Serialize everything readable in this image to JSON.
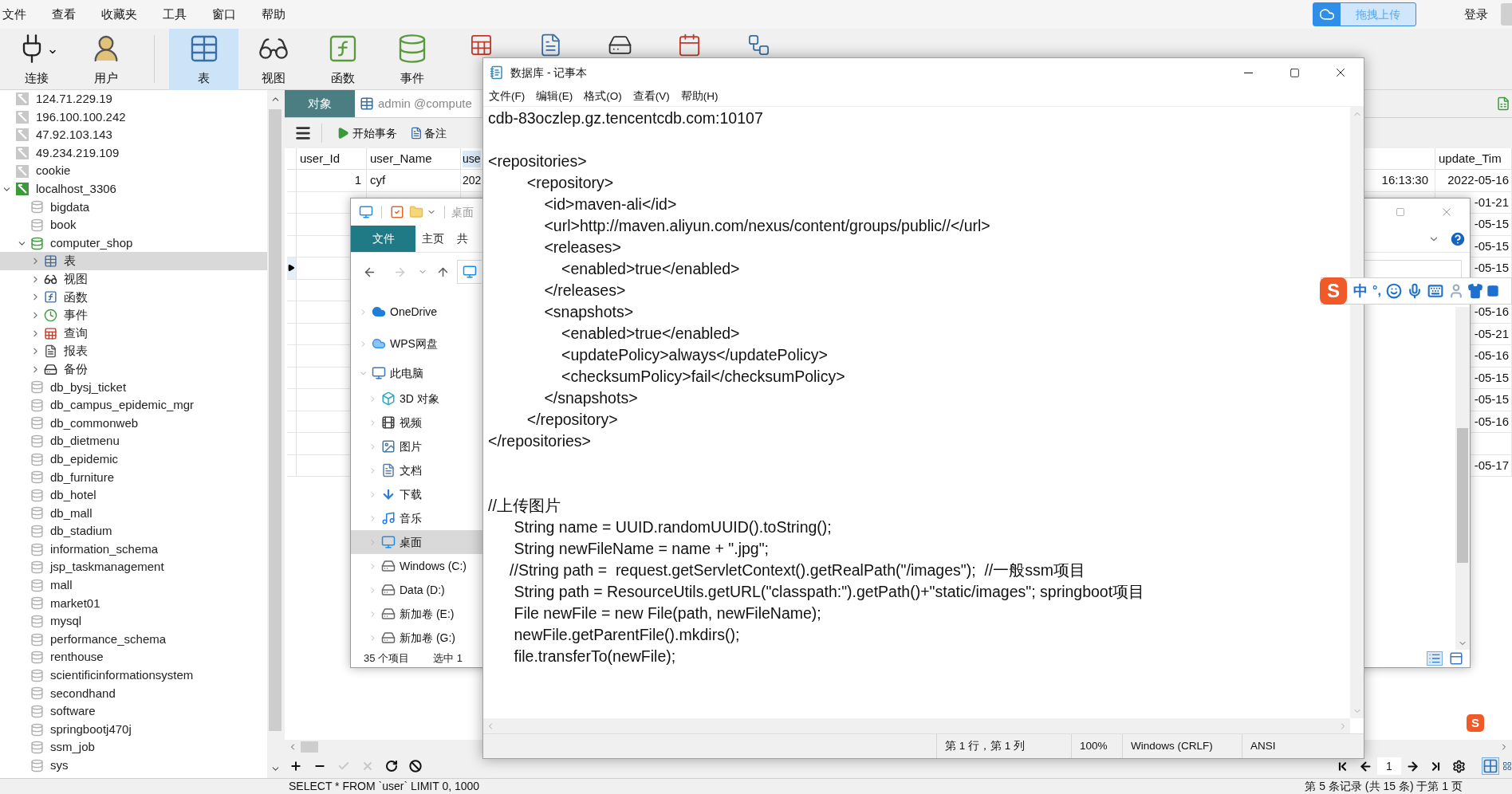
{
  "menu_bar": [
    "文件",
    "查看",
    "收藏夹",
    "工具",
    "窗口",
    "帮助"
  ],
  "upload_button": "拖拽上传",
  "login": "登录",
  "toolbar": {
    "groups": [
      [
        {
          "kind": "connection",
          "label": "连接",
          "selected": false
        },
        {
          "kind": "user",
          "label": "用户",
          "selected": false
        }
      ],
      [
        {
          "kind": "table",
          "label": "表",
          "selected": true
        },
        {
          "kind": "view",
          "label": "视图",
          "selected": false
        },
        {
          "kind": "function",
          "label": "函数",
          "selected": false
        },
        {
          "kind": "event",
          "label": "事件",
          "selected": false
        },
        {
          "kind": "query",
          "selected": false
        },
        {
          "kind": "report",
          "selected": false
        },
        {
          "kind": "backup",
          "selected": false
        },
        {
          "kind": "schedule",
          "selected": false
        },
        {
          "kind": "model",
          "selected": false
        }
      ]
    ]
  },
  "sidebar": {
    "items": [
      {
        "label": "124.71.229.19",
        "kind": "connection",
        "selected": false
      },
      {
        "label": "196.100.100.242",
        "kind": "connection",
        "selected": false
      },
      {
        "label": "47.92.103.143",
        "kind": "connection",
        "selected": false
      },
      {
        "label": "49.234.219.109",
        "kind": "connection",
        "selected": false
      },
      {
        "label": "cookie",
        "kind": "connection",
        "selected": false
      },
      {
        "label": "localhost_3306",
        "kind": "connection-open",
        "selected": false,
        "expanded": true,
        "children": [
          {
            "label": "bigdata",
            "kind": "database",
            "selected": false
          },
          {
            "label": "book",
            "kind": "database",
            "selected": false
          },
          {
            "label": "computer_shop",
            "kind": "database-open",
            "selected": false,
            "expanded": true,
            "children": [
              {
                "label": "表",
                "kind": "tables",
                "selected": true,
                "expanded": false
              },
              {
                "label": "视图",
                "kind": "views",
                "selected": false,
                "expanded": false
              },
              {
                "label": "函数",
                "kind": "functions",
                "selected": false,
                "expanded": false
              },
              {
                "label": "事件",
                "kind": "events",
                "selected": false,
                "expanded": false
              },
              {
                "label": "查询",
                "kind": "queries",
                "selected": false,
                "expanded": false
              },
              {
                "label": "报表",
                "kind": "reports",
                "selected": false,
                "expanded": false
              },
              {
                "label": "备份",
                "kind": "backups",
                "selected": false,
                "expanded": false
              }
            ]
          },
          {
            "label": "db_bysj_ticket",
            "kind": "database",
            "selected": false
          },
          {
            "label": "db_campus_epidemic_mgr",
            "kind": "database",
            "selected": false
          },
          {
            "label": "db_commonweb",
            "kind": "database",
            "selected": false
          },
          {
            "label": "db_dietmenu",
            "kind": "database",
            "selected": false
          },
          {
            "label": "db_epidemic",
            "kind": "database",
            "selected": false
          },
          {
            "label": "db_furniture",
            "kind": "database",
            "selected": false
          },
          {
            "label": "db_hotel",
            "kind": "database",
            "selected": false
          },
          {
            "label": "db_mall",
            "kind": "database",
            "selected": false
          },
          {
            "label": "db_stadium",
            "kind": "database",
            "selected": false
          },
          {
            "label": "information_schema",
            "kind": "database",
            "selected": false
          },
          {
            "label": "jsp_taskmanagement",
            "kind": "database",
            "selected": false
          },
          {
            "label": "mall",
            "kind": "database",
            "selected": false
          },
          {
            "label": "market01",
            "kind": "database",
            "selected": false
          },
          {
            "label": "mysql",
            "kind": "database",
            "selected": false
          },
          {
            "label": "performance_schema",
            "kind": "database",
            "selected": false
          },
          {
            "label": "renthouse",
            "kind": "database",
            "selected": false
          },
          {
            "label": "scientificinformationsystem",
            "kind": "database",
            "selected": false
          },
          {
            "label": "secondhand",
            "kind": "database",
            "selected": false
          },
          {
            "label": "software",
            "kind": "database",
            "selected": false
          },
          {
            "label": "springbootj470j",
            "kind": "database",
            "selected": false
          },
          {
            "label": "ssm_job",
            "kind": "database",
            "selected": false
          },
          {
            "label": "sys",
            "kind": "database",
            "selected": false
          }
        ]
      }
    ]
  },
  "tabs": [
    {
      "label": "对象",
      "kind": "objects",
      "selected": true
    },
    {
      "label": "admin @compute",
      "kind": "table",
      "selected": false
    }
  ],
  "object_toolbar": [
    {
      "kind": "transaction",
      "label": "开始事务"
    },
    {
      "kind": "memo",
      "label": "备注"
    }
  ],
  "table": {
    "headers": {
      "column_1": "user_Id",
      "column_2": "user_Name",
      "column_3": "use",
      "column_5": "update_Tim"
    },
    "rows": [
      {
        "selected": false,
        "cells": {
          "column_1": "1",
          "column_2": "cyf",
          "column_3": "202",
          "column_4": "16:13:30",
          "column_5": "2022-05-16"
        }
      },
      {
        "selected": false,
        "cells": {
          "column_5": "-01-21"
        }
      },
      {
        "selected": false,
        "cells": {
          "column_5": "-05-15"
        }
      },
      {
        "selected": false,
        "cells": {
          "column_5": "-05-15"
        }
      },
      {
        "selected": true,
        "cells": {
          "column_5": "-05-15"
        }
      },
      {
        "selected": false,
        "cells": {}
      },
      {
        "selected": false,
        "cells": {
          "column_5": "-05-16"
        }
      },
      {
        "selected": false,
        "cells": {
          "column_5": "-05-21"
        }
      },
      {
        "selected": false,
        "cells": {
          "column_5": "-05-16"
        }
      },
      {
        "selected": false,
        "cells": {
          "column_5": "-05-15"
        }
      },
      {
        "selected": false,
        "cells": {
          "column_5": "-05-15"
        }
      },
      {
        "selected": false,
        "cells": {
          "column_5": "-05-16"
        }
      },
      {
        "selected": false,
        "cells": {}
      },
      {
        "selected": false,
        "cells": {
          "column_5": "-05-17"
        }
      }
    ]
  },
  "page_field": "1",
  "status_bar": {
    "query": "SELECT * FROM `user` LIMIT 0, 1000",
    "record": "第 5 条记录 (共 15 条) 于第 1 页"
  },
  "explorer": {
    "title": "桌面",
    "ribbon_tabs": [
      {
        "label": "文件",
        "selected": true
      },
      {
        "label": "主页",
        "selected": false
      },
      {
        "label": "共",
        "selected": false
      }
    ],
    "nav": [
      {
        "label": "OneDrive",
        "kind": "onedrive",
        "selected": false,
        "expanded": false
      },
      {
        "label": "WPS网盘",
        "kind": "cloud",
        "selected": false,
        "expanded": false
      },
      {
        "label": "此电脑",
        "kind": "pc",
        "selected": false,
        "expanded": true,
        "children": [
          {
            "label": "3D 对象",
            "kind": "objects3d",
            "selected": false,
            "expanded": false
          },
          {
            "label": "视频",
            "kind": "videos",
            "selected": false,
            "expanded": false
          },
          {
            "label": "图片",
            "kind": "pictures",
            "selected": false,
            "expanded": false
          },
          {
            "label": "文档",
            "kind": "documents",
            "selected": false,
            "expanded": false
          },
          {
            "label": "下载",
            "kind": "downloads",
            "selected": false,
            "expanded": false
          },
          {
            "label": "音乐",
            "kind": "music",
            "selected": false,
            "expanded": false
          },
          {
            "label": "桌面",
            "kind": "desktop",
            "selected": true,
            "expanded": false
          },
          {
            "label": "Windows (C:)",
            "kind": "drive",
            "selected": false,
            "expanded": false
          },
          {
            "label": "Data (D:)",
            "kind": "drive",
            "selected": false,
            "expanded": false
          },
          {
            "label": "新加卷 (E:)",
            "kind": "drive",
            "selected": false,
            "expanded": false
          },
          {
            "label": "新加卷 (G:)",
            "kind": "drive",
            "selected": false,
            "expanded": false
          }
        ]
      }
    ],
    "status": {
      "count": "35 个项目",
      "selection": "选中 1"
    }
  },
  "notepad": {
    "title": "数据库 - 记事本",
    "menu": [
      "文件(F)",
      "编辑(E)",
      "格式(O)",
      "查看(V)",
      "帮助(H)"
    ],
    "blocks": [
      {
        "kind": "host",
        "lines": [
          "cdb-83oczlep.gz.tencentcdb.com:10107"
        ]
      },
      {
        "kind": "xml",
        "lines": [
          "<repositories>",
          "         <repository>",
          "             <id>maven-ali</id>",
          "             <url>http://maven.aliyun.com/nexus/content/groups/public//</url>",
          "             <releases>",
          "                 <enabled>true</enabled>",
          "             </releases>",
          "             <snapshots>",
          "                 <enabled>true</enabled>",
          "                 <updatePolicy>always</updatePolicy>",
          "                 <checksumPolicy>fail</checksumPolicy>",
          "             </snapshots>",
          "         </repository>",
          "</repositories>"
        ]
      },
      {
        "kind": "java",
        "lines": [
          "//上传图片",
          "      String name = UUID.randomUUID().toString();",
          "      String newFileName = name + \".jpg\";",
          "     //String path =  request.getServletContext().getRealPath(\"/images\");  //一般ssm项目",
          "      String path = ResourceUtils.getURL(\"classpath:\").getPath()+\"static/images\"; springboot项目",
          "      File newFile = new File(path, newFileName);",
          "      newFile.getParentFile().mkdirs();",
          "      file.transferTo(newFile);"
        ]
      }
    ],
    "status": [
      "第 1 行，第 1 列",
      "100%",
      "Windows (CRLF)",
      "ANSI"
    ]
  },
  "ime": {
    "logo": "S",
    "mode": "中",
    "punctuation": "°,"
  },
  "tray_logo": "S"
}
